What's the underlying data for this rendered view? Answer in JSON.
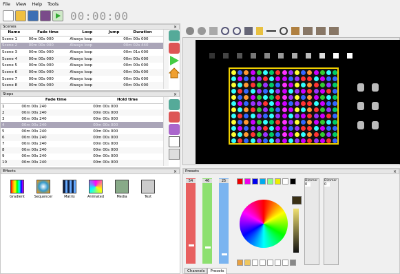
{
  "menu": {
    "file": "File",
    "view": "View",
    "help": "Help",
    "tools": "Tools"
  },
  "toolbar": {
    "timer": "00:00:00"
  },
  "scenes": {
    "title": "Scenes",
    "headers": [
      "Name",
      "Fade time",
      "Loop",
      "Jump",
      "Duration"
    ],
    "rows": [
      [
        "Scene 1",
        "00m 00s 000",
        "Always loop",
        "",
        "00m 00s 000"
      ],
      [
        "Scene 2",
        "00m 00s 000",
        "Always loop",
        "",
        "00m 02s 440"
      ],
      [
        "Scene 3",
        "00m 00s 000",
        "Always loop",
        "",
        "00m 01s 000"
      ],
      [
        "Scene 4",
        "00m 00s 000",
        "Always loop",
        "",
        "00m 00s 000"
      ],
      [
        "Scene 5",
        "00m 00s 000",
        "Always loop",
        "",
        "00m 00s 000"
      ],
      [
        "Scene 6",
        "00m 00s 000",
        "Always loop",
        "",
        "00m 00s 000"
      ],
      [
        "Scene 7",
        "00m 00s 000",
        "Always loop",
        "",
        "00m 00s 000"
      ],
      [
        "Scene 8",
        "00m 00s 000",
        "Always loop",
        "",
        "00m 00s 000"
      ]
    ]
  },
  "steps": {
    "title": "Steps",
    "headers": [
      "",
      "Fade time",
      "Hold time"
    ],
    "rows": [
      [
        "1",
        "00m 00s 240",
        "00m 00s 000"
      ],
      [
        "2",
        "00m 00s 240",
        "00m 00s 000"
      ],
      [
        "3",
        "00m 00s 240",
        "00m 00s 000"
      ],
      [
        "4",
        "00m 00s 240",
        "00m 00s 000"
      ],
      [
        "5",
        "00m 00s 240",
        "00m 00s 000"
      ],
      [
        "6",
        "00m 00s 240",
        "00m 00s 000"
      ],
      [
        "7",
        "00m 00s 240",
        "00m 00s 000"
      ],
      [
        "8",
        "00m 00s 240",
        "00m 00s 000"
      ],
      [
        "9",
        "00m 00s 240",
        "00m 00s 000"
      ],
      [
        "10",
        "00m 00s 240",
        "00m 00s 000"
      ]
    ]
  },
  "effects": {
    "title": "Effects",
    "items": [
      "Gradient",
      "Sequencer",
      "Matrix",
      "Animated",
      "Media",
      "Text"
    ]
  },
  "presets": {
    "title": "Presets",
    "slider_values": [
      "54",
      "46",
      "25"
    ],
    "dimmer_labels": [
      "Dimmer",
      "Dimmer"
    ],
    "dimmer_values": [
      "0",
      "0"
    ],
    "tabs": [
      "Channels",
      "Presets"
    ]
  },
  "window_controls": "×",
  "colors": {
    "selected_row": "#aaa5b8"
  }
}
